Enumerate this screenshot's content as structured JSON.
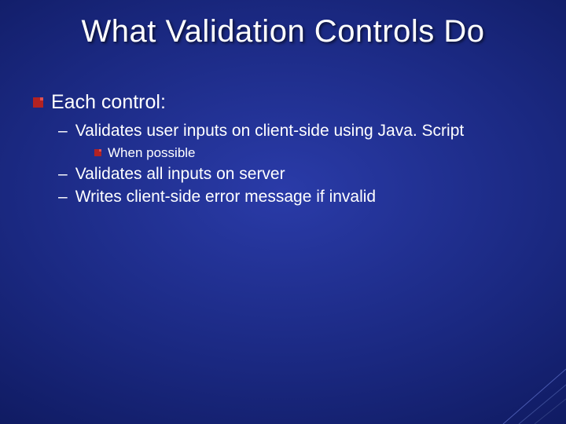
{
  "title": "What Validation Controls Do",
  "level1_text": "Each control:",
  "sub1": "Validates user inputs on client-side using Java. Script",
  "sub1_note": "When possible",
  "sub2": "Validates all inputs on server",
  "sub3": "Writes client-side error message if invalid"
}
